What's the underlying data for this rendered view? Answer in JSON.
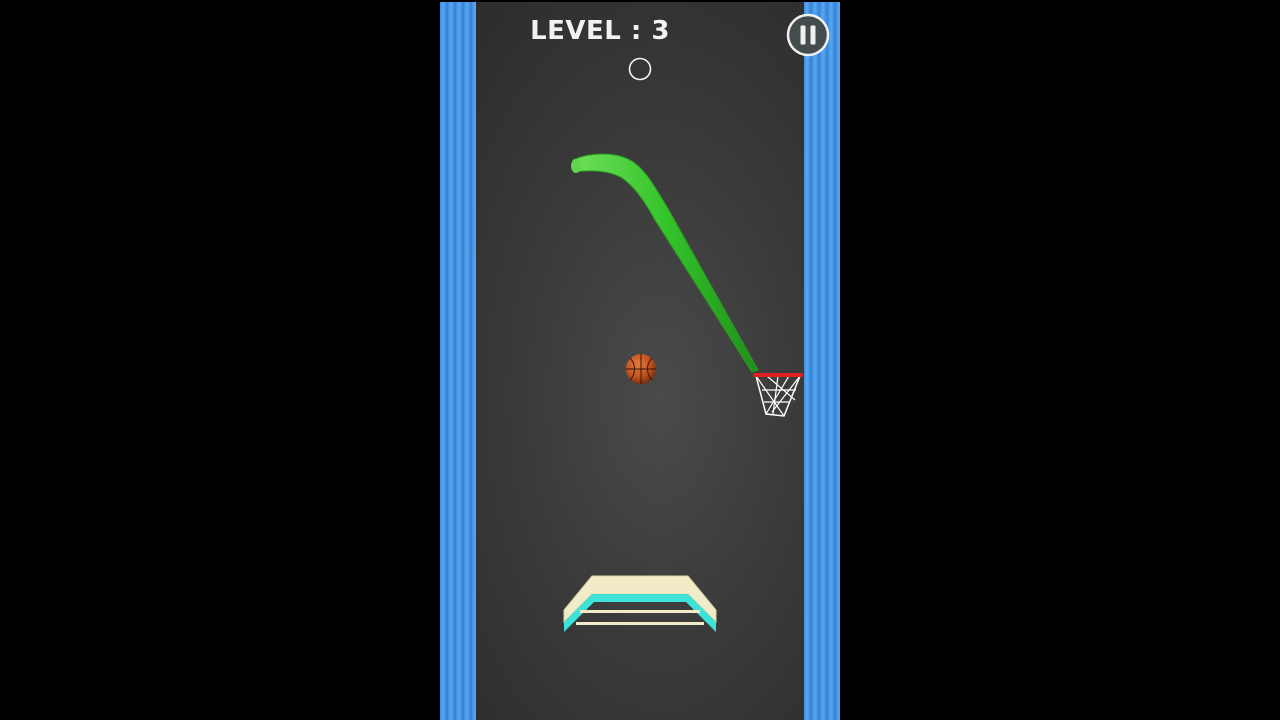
{
  "hud": {
    "level_label": "LEVEL : 3",
    "pause_icon": "pause-icon"
  },
  "game": {
    "colors": {
      "background": "#000000",
      "court": "#333333",
      "wall": "#3e8fe0",
      "ramp": "#35c42b",
      "ball": "#c0521f",
      "rim": "#e02020",
      "net": "#ffffff",
      "launcher_top": "#f1ecc7",
      "launcher_edge": "#3fe2d9"
    },
    "elements": [
      "aim-indicator",
      "green-ramp",
      "basketball",
      "basketball-hoop",
      "launcher-platform"
    ]
  }
}
